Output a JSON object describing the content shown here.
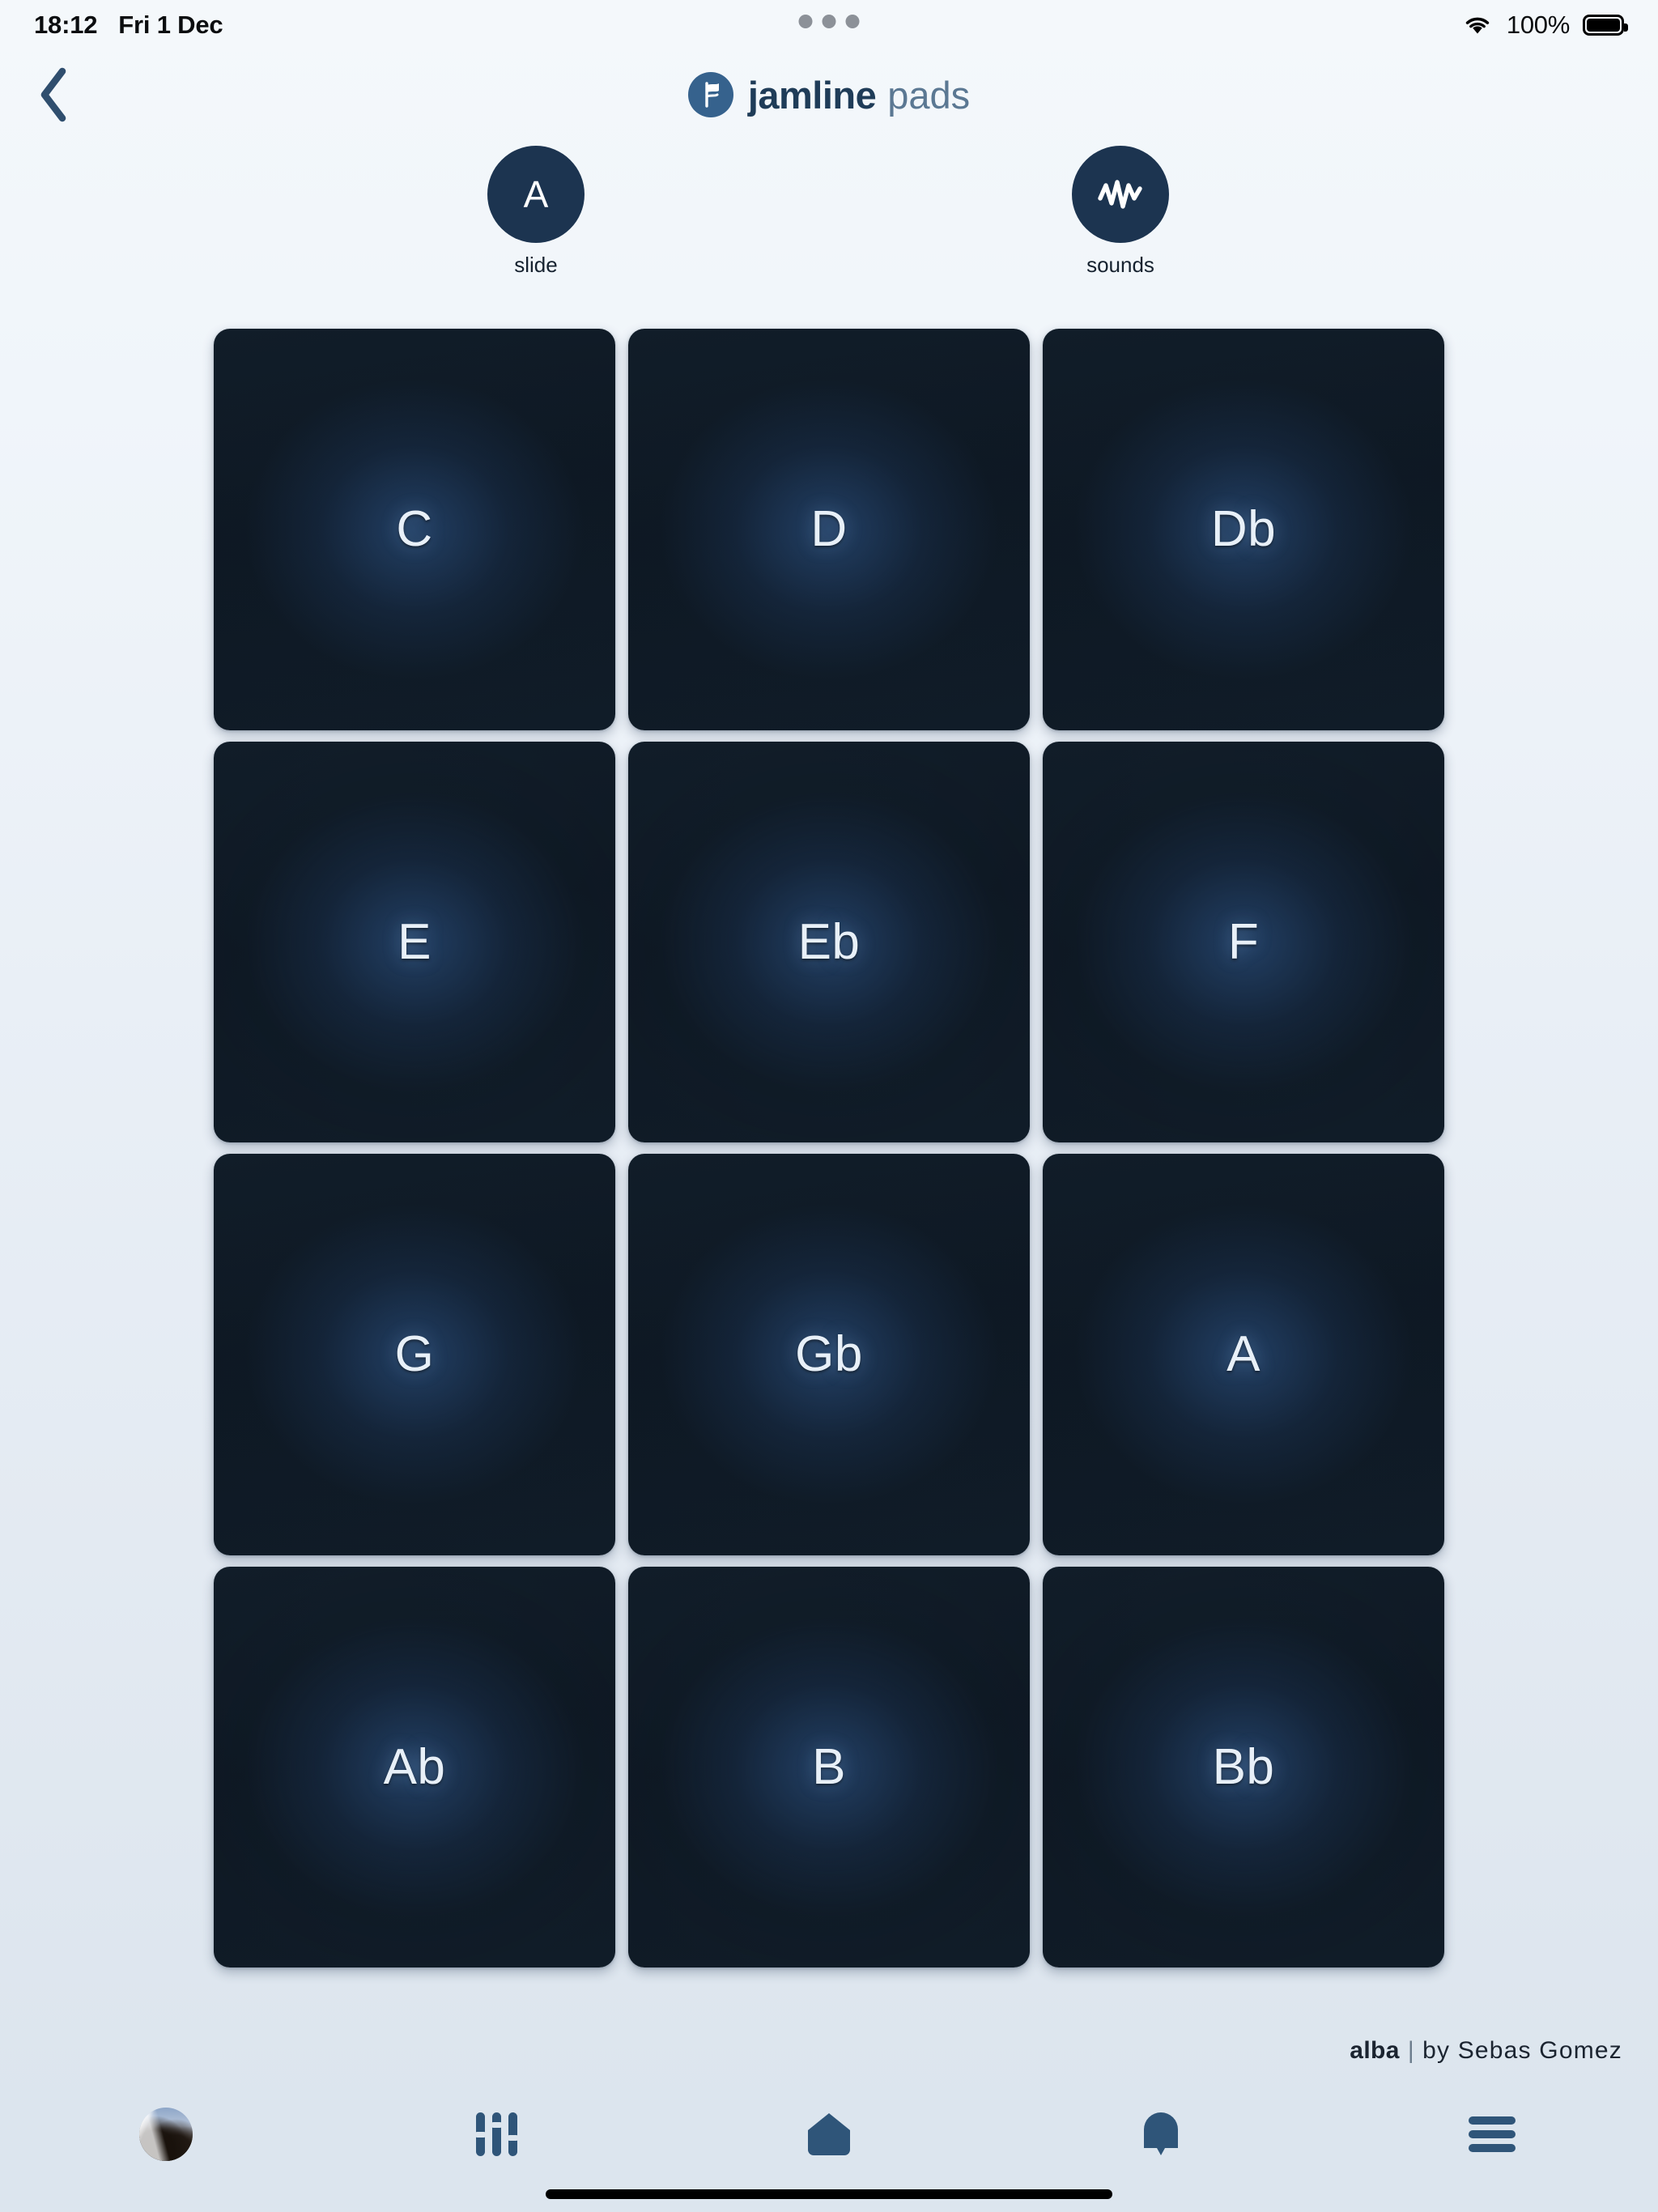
{
  "status_bar": {
    "time": "18:12",
    "date": "Fri 1 Dec",
    "battery_percent": "100%",
    "wifi_icon": "wifi-icon",
    "battery_icon": "battery-full-icon",
    "multitask_dots": "multitasking-dots-icon"
  },
  "header": {
    "back_icon": "chevron-left-icon",
    "logo_icon": "jamline-logo-icon",
    "brand_name": "jamline",
    "brand_suffix": "pads"
  },
  "controls": [
    {
      "id": "slide",
      "value": "A",
      "label": "slide",
      "icon": "letter-a-icon"
    },
    {
      "id": "sounds",
      "value": "",
      "label": "sounds",
      "icon": "waveform-icon"
    }
  ],
  "pads": [
    {
      "label": "C"
    },
    {
      "label": "D"
    },
    {
      "label": "Db"
    },
    {
      "label": "E"
    },
    {
      "label": "Eb"
    },
    {
      "label": "F"
    },
    {
      "label": "G"
    },
    {
      "label": "Gb"
    },
    {
      "label": "A"
    },
    {
      "label": "Ab"
    },
    {
      "label": "B"
    },
    {
      "label": "Bb"
    }
  ],
  "credit": {
    "title": "alba",
    "separator": "|",
    "author": "by Sebas Gomez"
  },
  "tabbar": [
    {
      "id": "profile",
      "icon": "avatar-icon"
    },
    {
      "id": "mixer",
      "icon": "sliders-icon"
    },
    {
      "id": "home",
      "icon": "home-icon"
    },
    {
      "id": "notices",
      "icon": "bell-icon"
    },
    {
      "id": "menu",
      "icon": "hamburger-menu-icon"
    }
  ],
  "colors": {
    "brand_dark": "#1f3c58",
    "brand_light": "#5b7893",
    "accent_circle": "#1c3450",
    "pad_base": "#111d29",
    "pad_glow": "#2e578c",
    "tab_icon": "#2f5madeup",
    "tab_icon_blue": "#2f5579",
    "tabbar_bg": "#dce5ee"
  }
}
